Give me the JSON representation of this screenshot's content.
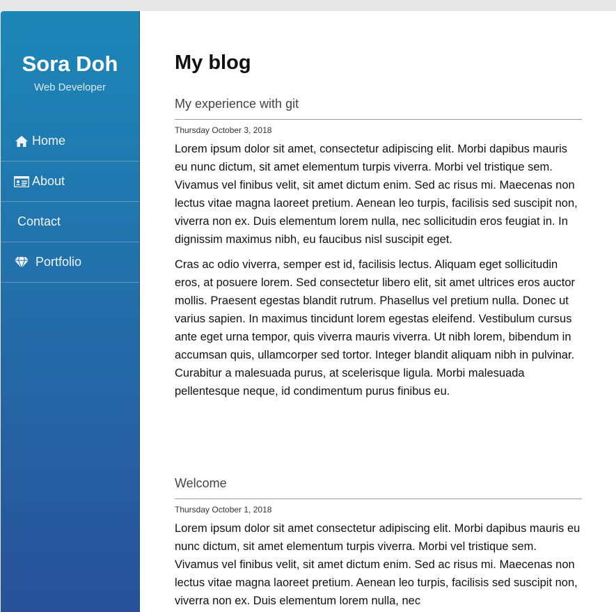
{
  "sidebar": {
    "name": "Sora Doh",
    "role": "Web Developer",
    "nav": [
      {
        "label": "Home",
        "icon": "home-icon"
      },
      {
        "label": "About",
        "icon": "id-card-icon"
      },
      {
        "label": "Contact",
        "icon": ""
      },
      {
        "label": "Portfolio",
        "icon": "diamond-icon"
      }
    ]
  },
  "main": {
    "title": "My blog",
    "posts": [
      {
        "title": "My experience with git",
        "date": "Thursday October 3, 2018",
        "paragraphs": [
          "Lorem ipsum dolor sit amet, consectetur adipiscing elit. Morbi dapibus mauris eu nunc dictum, sit amet elementum turpis viverra. Morbi vel tristique sem. Vivamus vel finibus velit, sit amet dictum enim. Sed ac risus mi. Maecenas non lectus vitae magna laoreet pretium. Aenean leo turpis, facilisis sed suscipit non, viverra non ex. Duis elementum lorem nulla, nec sollicitudin eros feugiat in. In dignissim maximus nibh, eu faucibus nisl suscipit eget.",
          "Cras ac odio viverra, semper est id, facilisis lectus. Aliquam eget sollicitudin eros, at posuere lorem. Sed consectetur libero elit, sit amet ultrices eros auctor mollis. Praesent egestas blandit rutrum. Phasellus vel pretium nulla. Donec ut varius sapien. In maximus tincidunt lorem egestas eleifend. Vestibulum cursus ante eget urna tempor, quis viverra mauris viverra. Ut nibh lorem, bibendum in accumsan quis, ullamcorper sed tortor. Integer blandit aliquam nibh in pulvinar. Curabitur a malesuada purus, at scelerisque ligula. Morbi malesuada pellentesque neque, id condimentum purus finibus eu."
        ]
      },
      {
        "title": "Welcome",
        "date": "Thursday October 1, 2018",
        "paragraphs": [
          "Lorem ipsum dolor sit amet consectetur adipiscing elit. Morbi dapibus mauris eu nunc dictum, sit amet elementum turpis viverra. Morbi vel tristique sem. Vivamus vel finibus velit, sit amet dictum enim. Sed ac risus mi. Maecenas non lectus vitae magna laoreet pretium. Aenean leo turpis, facilisis sed suscipit non, viverra non ex. Duis elementum lorem nulla, nec"
        ]
      }
    ]
  }
}
